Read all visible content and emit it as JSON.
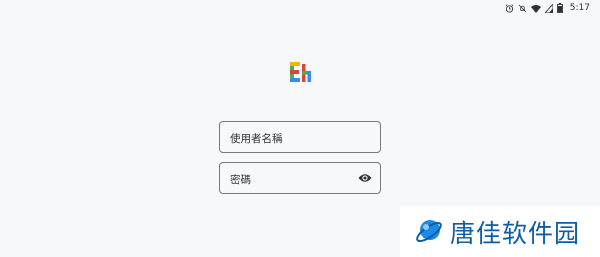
{
  "status_bar": {
    "time": "5:17",
    "icons": [
      "alarm-icon",
      "mute-icon",
      "wifi-icon",
      "signal-icon",
      "battery-icon"
    ]
  },
  "app_logo": {
    "icon": "ehviewer-logo-icon",
    "colors": [
      "#4caf50",
      "#f4b400",
      "#db4437",
      "#4285f4"
    ]
  },
  "login": {
    "username_placeholder": "使用者名稱",
    "password_placeholder": "密碼",
    "password_toggle_icon": "eye-icon"
  },
  "watermark": {
    "text": "唐佳软件园",
    "color": "#0d5ea8"
  }
}
